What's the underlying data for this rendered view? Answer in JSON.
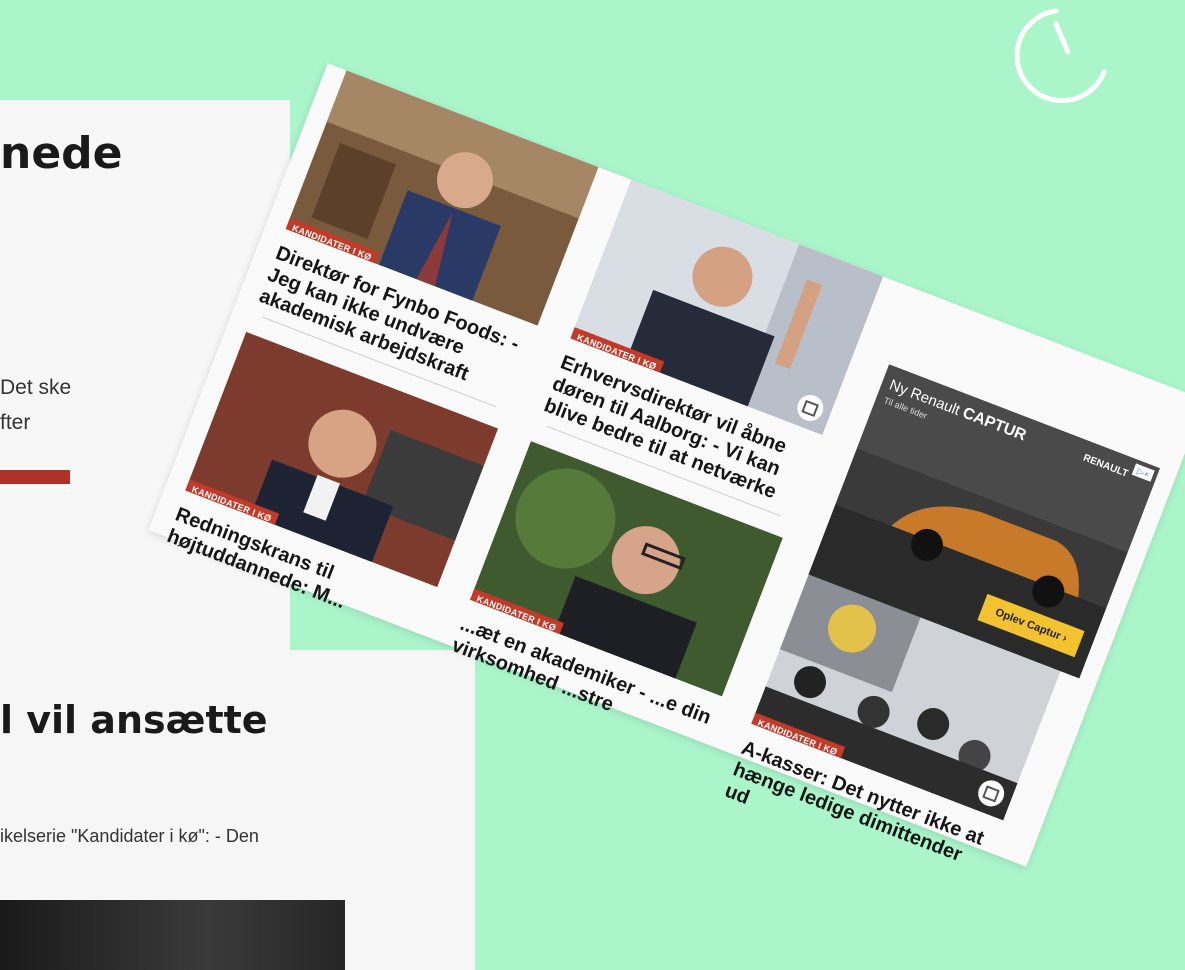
{
  "background_left_top": {
    "title": "nede",
    "lines": [
      "Det ske",
      "fter"
    ]
  },
  "background_left_bottom": {
    "title": "l vil ansætte",
    "line": "ikelserie \"Kandidater i kø\": - Den"
  },
  "badge_label": "KANDIDATER I KØ",
  "articles": [
    {
      "headline": "Direktør for Fynbo Foods: - Jeg kan ikke undvære akademisk arbejdskraft"
    },
    {
      "headline": "Erhvervsdirektør vil åbne døren til Aalborg: - Vi kan blive bedre til at netværke"
    },
    {
      "headline": "Redningskrans til højtuddannede: M..."
    },
    {
      "headline": "...æt en akademiker - ...e din virksomhed ...stre"
    },
    {
      "headline": "A-kasser: Det nytter ikke at hænge ledige dimittender ud"
    }
  ],
  "ad": {
    "brand_prefix": "Ny",
    "brand": "Renault",
    "model": "CAPTUR",
    "tagline": "Til alle tider",
    "logo": "RENAULT",
    "adchoices": "▷×",
    "cta": "Oplev Captur  ›"
  },
  "icons": {
    "clock": "clock-icon",
    "image": "image-icon"
  },
  "colors": {
    "background": "#abf5cb",
    "badge": "#c13a2a",
    "cta": "#f2c230"
  }
}
